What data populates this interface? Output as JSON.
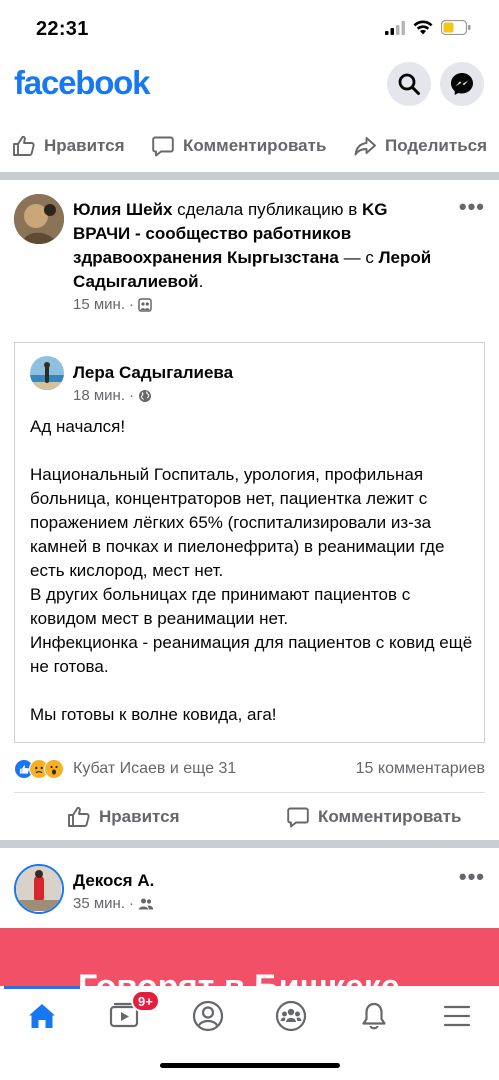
{
  "status": {
    "time": "22:31"
  },
  "header": {
    "logo": "facebook",
    "search_icon": "search-icon",
    "messenger_icon": "messenger-icon"
  },
  "top_actions": {
    "like": "Нравится",
    "comment": "Комментировать",
    "share": "Поделиться"
  },
  "post": {
    "author": "Юлия Шейх",
    "action_text": " сделала публикацию в ",
    "group": "KG ВРАЧИ - сообщество работников здравоохранения Кыргызстана",
    "with_text": " — с ",
    "tagged": "Лерой Садыгалиевой",
    "period": ".",
    "time": "15 мин.",
    "separator": "·",
    "shared": {
      "author": "Лера Садыгалиева",
      "time": "18 мин.",
      "separator": "·",
      "text": "Ад начался!\n\nНациональный Госпиталь, урология, профильная больница, концентраторов нет, пациентка лежит с поражением лёгких 65% (госпитализировали из-за камней в почках и пиелонефрита) в реанимации где есть кислород, мест нет.\nВ других больницах где принимают пациентов с ковидом мест в реанимации нет.\nИнфекционка - реанимация для пациентов с ковид ещё не готова.\n\nМы готовы к волне ковида, ага!"
    },
    "reactions_text": "Кубат Исаев и еще 31",
    "comments_count": "15 комментариев",
    "like_label": "Нравится",
    "comment_label": "Комментировать"
  },
  "next_post": {
    "author": "Декося А.",
    "time": "35 мин.",
    "separator": "·",
    "banner_text": "Говорят в Бишкеке"
  },
  "tabbar": {
    "video_badge": "9+"
  },
  "colors": {
    "brand": "#1877f2",
    "banner": "#f25066",
    "badge": "#e41e3f"
  }
}
